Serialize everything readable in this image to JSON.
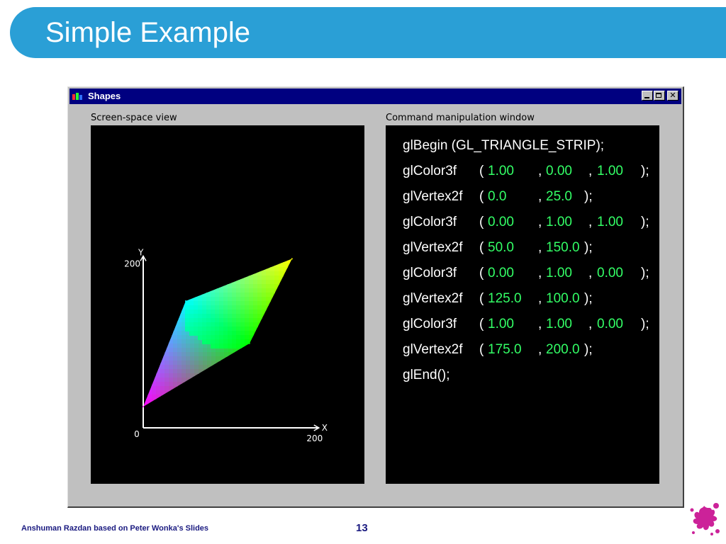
{
  "slide": {
    "title": "Simple Example",
    "footer": "Anshuman Razdan based on Peter Wonka's Slides",
    "page_number": "13"
  },
  "window": {
    "title": "Shapes",
    "app_icon": "opengl-shapes-icon",
    "controls": {
      "minimize": "minimize-icon",
      "maximize": "maximize-icon",
      "close": "close-icon",
      "close_glyph": "✕"
    }
  },
  "left_panel": {
    "label": "Screen-space view",
    "axis": {
      "x_label": "X",
      "y_label": "Y",
      "origin": "0",
      "x_max": "200",
      "y_max": "200"
    },
    "vertices": [
      {
        "x": 0.0,
        "y": 25.0,
        "color": "#ff00ff"
      },
      {
        "x": 50.0,
        "y": 150.0,
        "color": "#00ffff"
      },
      {
        "x": 125.0,
        "y": 100.0,
        "color": "#00ff00"
      },
      {
        "x": 175.0,
        "y": 200.0,
        "color": "#ffff00"
      }
    ]
  },
  "right_panel": {
    "label": "Command manipulation window",
    "lines": [
      {
        "text": "glBegin (GL_TRIANGLE_STRIP);"
      },
      {
        "fn": "glColor3f",
        "open": "(",
        "a": "1.00",
        "b": "0.00",
        "c": "1.00",
        "close": ");"
      },
      {
        "fn": "glVertex2f",
        "open": "(",
        "a": "0.0",
        "b": "25.0",
        "close": ");"
      },
      {
        "fn": "glColor3f",
        "open": "(",
        "a": "0.00",
        "b": "1.00",
        "c": "1.00",
        "close": ");"
      },
      {
        "fn": "glVertex2f",
        "open": "(",
        "a": "50.0",
        "b": "150.0",
        "close": ");"
      },
      {
        "fn": "glColor3f",
        "open": "(",
        "a": "0.00",
        "b": "1.00",
        "c": "0.00",
        "close": ");"
      },
      {
        "fn": "glVertex2f",
        "open": "(",
        "a": "125.0",
        "b": "100.0",
        "close": ");"
      },
      {
        "fn": "glColor3f",
        "open": "(",
        "a": "1.00",
        "b": "1.00",
        "c": "0.00",
        "close": ");"
      },
      {
        "fn": "glVertex2f",
        "open": "(",
        "a": "175.0",
        "b": "200.0",
        "close": ");"
      },
      {
        "text": "glEnd();"
      }
    ],
    "separator": ",",
    "value_color": "#33ff66"
  },
  "colors": {
    "title_bar": "#2a9fd6",
    "window_titlebar": "#000080",
    "footer_text": "#1a1a80",
    "splat": "#cc2299"
  }
}
